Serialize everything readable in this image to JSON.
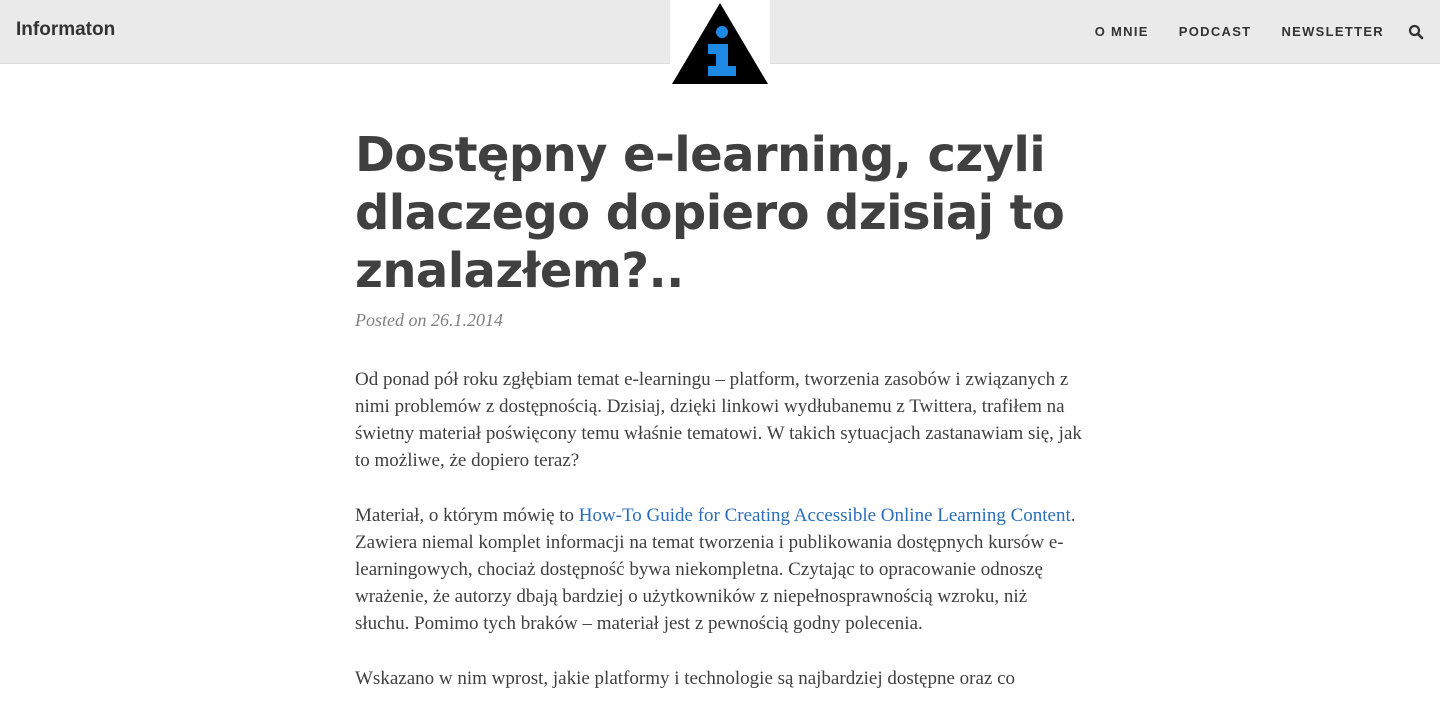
{
  "header": {
    "site_title": "Informaton",
    "logo_icon": "info-triangle-logo",
    "nav": [
      {
        "label": "O MNIE"
      },
      {
        "label": "PODCAST"
      },
      {
        "label": "NEWSLETTER"
      }
    ],
    "search_icon": "search-icon"
  },
  "article": {
    "title": "Dostępny e-learning, czyli dlaczego dopiero dzisiaj to znalazłem?..",
    "posted_prefix": "Posted on",
    "date": "26.1.2014",
    "paragraph_1": "Od ponad pół roku zgłębiam temat e-learningu – platform, tworzenia zasobów i związanych z nimi problemów z dostępnością. Dzisiaj, dzięki linkowi wydłubanemu z Twittera, trafiłem na świetny materiał poświęcony temu właśnie tematowi. W takich sytuacjach zastanawiam się, jak to możliwe, że dopiero teraz?",
    "paragraph_2_before": "Materiał, o którym mówię to ",
    "paragraph_2_link": "How-To Guide for Creating Accessible Online Learning Content",
    "paragraph_2_after": ". Zawiera niemal komplet informacji na temat tworzenia i publikowania dostępnych kursów e-learningowych, chociaż dostępność bywa niekompletna. Czytając to opracowanie odnoszę wrażenie, że autorzy dbają bardziej o użytkowników z niepełnosprawnością wzroku, niż słuchu. Pomimo tych braków – materiał jest z pewnością godny polecenia.",
    "paragraph_3": "Wskazano w nim wprost, jakie platformy i technologie są najbardziej dostępne oraz co"
  },
  "colors": {
    "header_bg": "#eaeaea",
    "text": "#404040",
    "meta": "#808080",
    "link": "#2a6ebb",
    "logo_triangle": "#000000",
    "logo_glyph": "#1e88e5"
  }
}
